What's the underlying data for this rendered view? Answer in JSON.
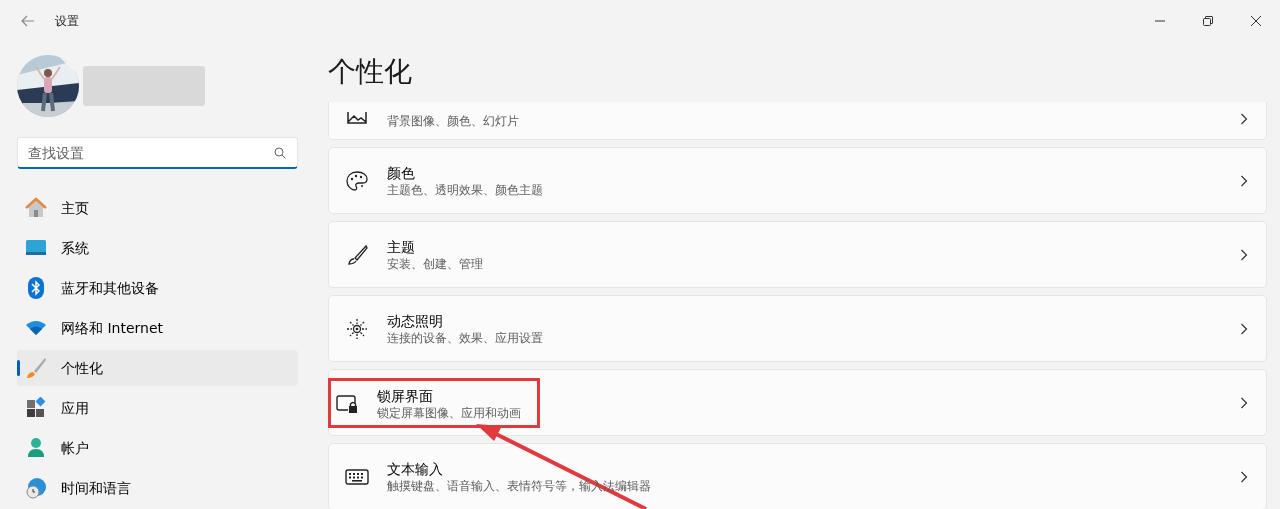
{
  "window": {
    "title": "设置"
  },
  "search": {
    "placeholder": "查找设置"
  },
  "sidebar": {
    "items": [
      {
        "label": "主页",
        "selected": false
      },
      {
        "label": "系统",
        "selected": false
      },
      {
        "label": "蓝牙和其他设备",
        "selected": false
      },
      {
        "label": "网络和 Internet",
        "selected": false
      },
      {
        "label": "个性化",
        "selected": true
      },
      {
        "label": "应用",
        "selected": false
      },
      {
        "label": "帐户",
        "selected": false
      },
      {
        "label": "时间和语言",
        "selected": false
      }
    ]
  },
  "page": {
    "title": "个性化",
    "items": [
      {
        "subtitle": "背景图像、颜色、幻灯片",
        "highlighted": false
      },
      {
        "title": "颜色",
        "subtitle": "主题色、透明效果、颜色主题",
        "highlighted": false
      },
      {
        "title": "主题",
        "subtitle": "安装、创建、管理",
        "highlighted": false
      },
      {
        "title": "动态照明",
        "subtitle": "连接的设备、效果、应用设置",
        "highlighted": false
      },
      {
        "title": "锁屏界面",
        "subtitle": "锁定屏幕图像、应用和动画",
        "highlighted": true
      },
      {
        "title": "文本输入",
        "subtitle": "触摸键盘、语音输入、表情符号等，输入法编辑器",
        "highlighted": false
      }
    ]
  }
}
